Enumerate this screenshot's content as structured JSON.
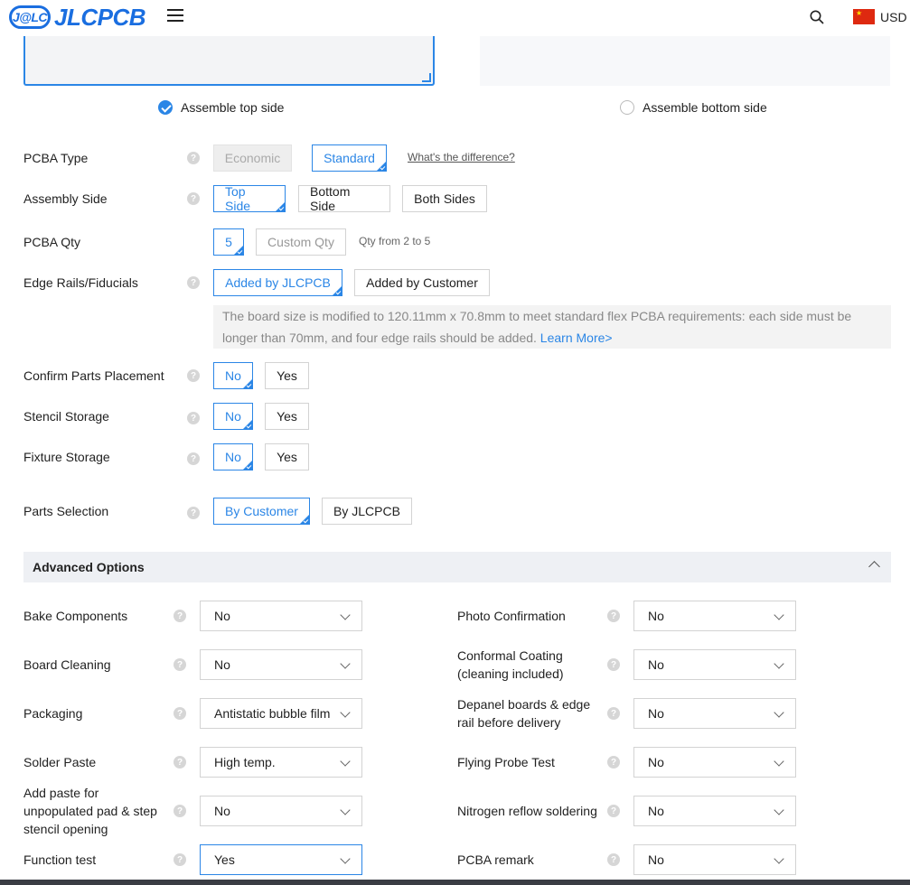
{
  "header": {
    "logo_mark": "J@LC",
    "logo_text": "JLCPCB",
    "currency": "USD",
    "colors": {
      "brand": "#1a6ee0",
      "accent": "#2b86e6"
    }
  },
  "assemble_side_radio": {
    "top": "Assemble top side",
    "bottom": "Assemble bottom side",
    "selected": "top"
  },
  "pcba_type": {
    "label": "PCBA Type",
    "options": [
      "Economic",
      "Standard"
    ],
    "selected": "Standard",
    "diff_link": "What's the difference?"
  },
  "assembly_side": {
    "label": "Assembly Side",
    "options": [
      "Top Side",
      "Bottom Side",
      "Both Sides"
    ],
    "selected": "Top Side"
  },
  "pcba_qty": {
    "label": "PCBA Qty",
    "value": "5",
    "custom": "Custom Qty",
    "hint": "Qty from 2 to 5"
  },
  "edge_rails": {
    "label": "Edge Rails/Fiducials",
    "options": [
      "Added by JLCPCB",
      "Added by Customer"
    ],
    "selected": "Added by JLCPCB",
    "notice": "The board size is modified to 120.11mm x 70.8mm to meet standard flex PCBA requirements: each side must be longer than 70mm, and four edge rails should be added.",
    "learn_more": "Learn More>"
  },
  "confirm_parts": {
    "label": "Confirm Parts Placement",
    "options": [
      "No",
      "Yes"
    ],
    "selected": "No"
  },
  "stencil_storage": {
    "label": "Stencil Storage",
    "options": [
      "No",
      "Yes"
    ],
    "selected": "No"
  },
  "fixture_storage": {
    "label": "Fixture Storage",
    "options": [
      "No",
      "Yes"
    ],
    "selected": "No"
  },
  "parts_selection": {
    "label": "Parts Selection",
    "options": [
      "By Customer",
      "By JLCPCB"
    ],
    "selected": "By Customer"
  },
  "advanced": {
    "title": "Advanced Options",
    "left": [
      {
        "label": "Bake Components",
        "value": "No"
      },
      {
        "label": "Board Cleaning",
        "value": "No"
      },
      {
        "label": "Packaging",
        "value": "Antistatic bubble film"
      },
      {
        "label": "Solder Paste",
        "value": "High temp."
      },
      {
        "label": "Add paste for unpopulated pad & step stencil opening",
        "value": "No"
      },
      {
        "label": "Function test",
        "value": "Yes"
      }
    ],
    "right": [
      {
        "label": "Photo Confirmation",
        "value": "No"
      },
      {
        "label": "Conformal Coating (cleaning included)",
        "value": "No"
      },
      {
        "label": "Depanel boards & edge rail before delivery",
        "value": "No"
      },
      {
        "label": "Flying Probe Test",
        "value": "No"
      },
      {
        "label": "Nitrogen reflow soldering",
        "value": "No"
      },
      {
        "label": "PCBA remark",
        "value": "No"
      }
    ]
  }
}
